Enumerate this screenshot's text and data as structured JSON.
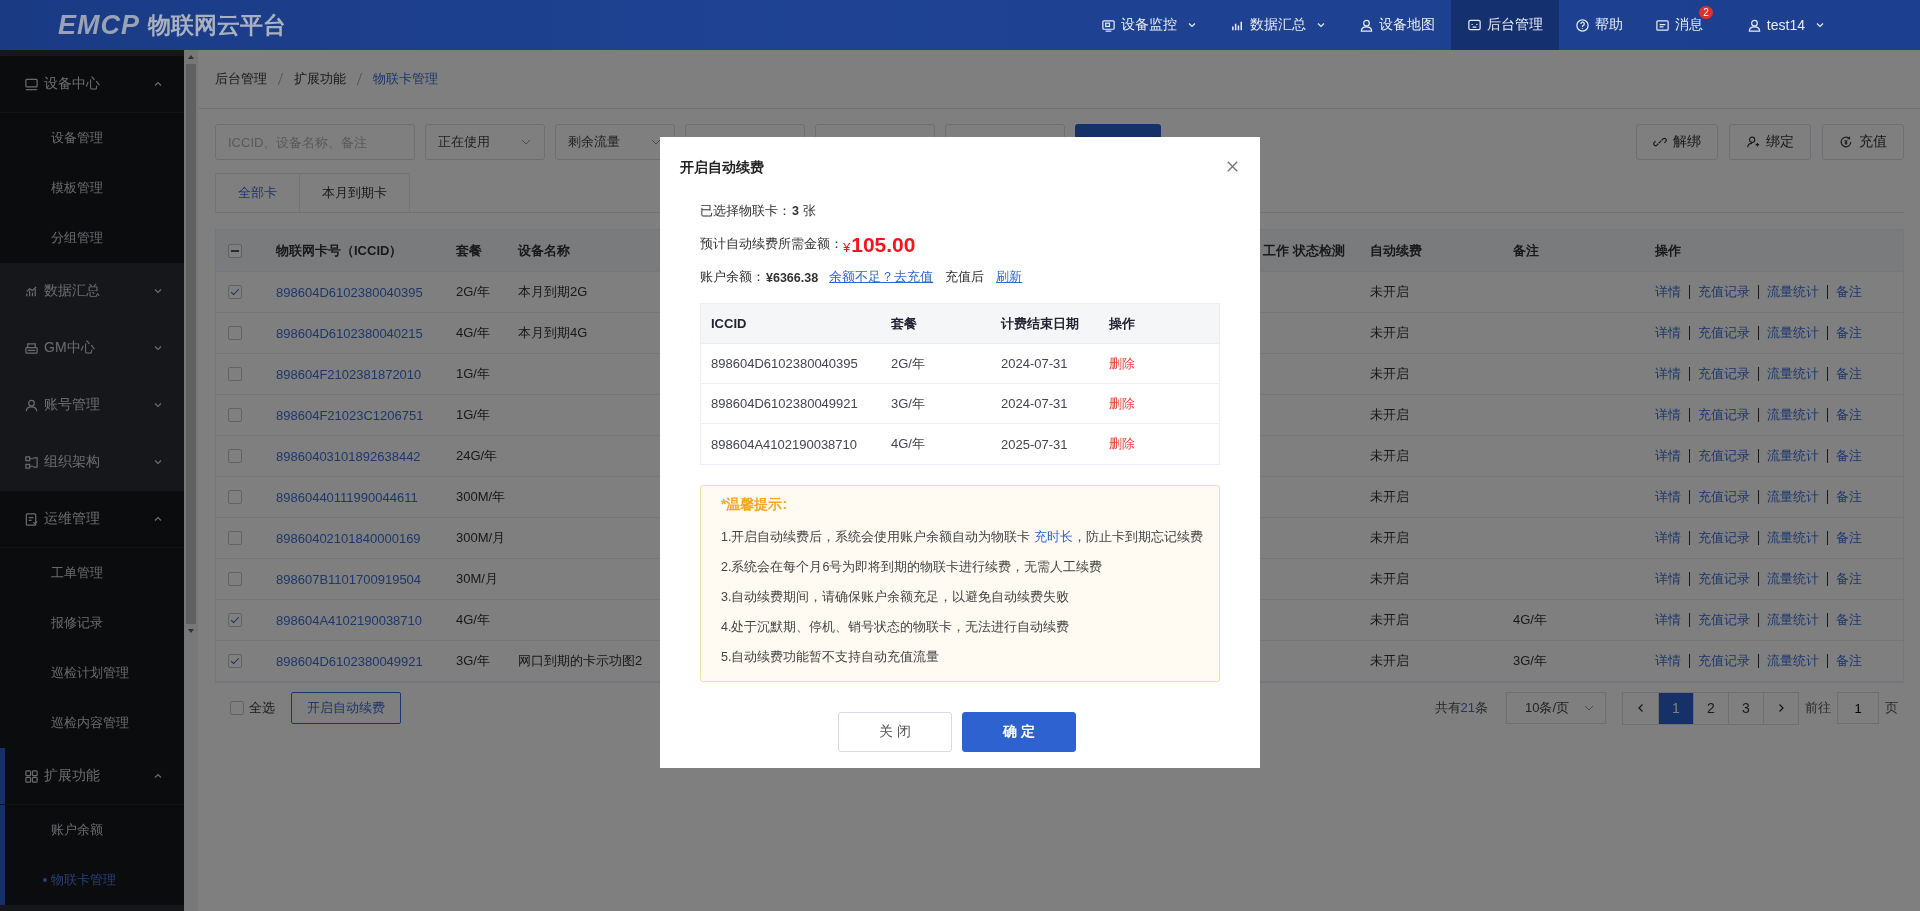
{
  "header": {
    "logo_mark": "EMCP",
    "logo_text": "物联网云平台",
    "nav": [
      {
        "label": "设备监控",
        "dropdown": true,
        "selected": false
      },
      {
        "label": "数据汇总",
        "dropdown": true,
        "selected": false
      },
      {
        "label": "设备地图",
        "dropdown": false,
        "selected": false
      },
      {
        "label": "后台管理",
        "dropdown": false,
        "selected": true
      },
      {
        "label": "帮助",
        "dropdown": false,
        "selected": false
      },
      {
        "label": "消息",
        "dropdown": false,
        "selected": false,
        "badge": "2"
      }
    ],
    "user": {
      "name": "test14",
      "dropdown": true
    }
  },
  "sidebar": {
    "groups": [
      {
        "label": "设备中心",
        "expanded": true,
        "active": false,
        "children": [
          {
            "label": "设备管理",
            "selected": false
          },
          {
            "label": "模板管理",
            "selected": false
          },
          {
            "label": "分组管理",
            "selected": false
          }
        ]
      },
      {
        "label": "数据汇总",
        "expanded": false,
        "active": false
      },
      {
        "label": "GM中心",
        "expanded": false,
        "active": false
      },
      {
        "label": "账号管理",
        "expanded": false,
        "active": false
      },
      {
        "label": "组织架构",
        "expanded": false,
        "active": false
      },
      {
        "label": "运维管理",
        "expanded": true,
        "active": false,
        "children": [
          {
            "label": "工单管理",
            "selected": false
          },
          {
            "label": "报修记录",
            "selected": false
          },
          {
            "label": "巡检计划管理",
            "selected": false
          },
          {
            "label": "巡检内容管理",
            "selected": false
          }
        ]
      },
      {
        "label": "扩展功能",
        "expanded": true,
        "active": true,
        "children": [
          {
            "label": "账户余额",
            "selected": false
          },
          {
            "label": "物联卡管理",
            "selected": true
          }
        ]
      }
    ]
  },
  "breadcrumb": [
    "后台管理",
    "扩展功能",
    "物联卡管理"
  ],
  "filters": [
    {
      "kind": "search",
      "placeholder": "ICCID、设备名称、备注"
    },
    {
      "kind": "select",
      "value": "正在使用"
    },
    {
      "kind": "select",
      "value": "剩余流量"
    },
    {
      "kind": "select"
    },
    {
      "kind": "select"
    },
    {
      "kind": "select"
    },
    {
      "kind": "button"
    }
  ],
  "actions": [
    "解绑",
    "绑定",
    "充值"
  ],
  "tabs": [
    {
      "label": "全部卡",
      "selected": true
    },
    {
      "label": "本月到期卡",
      "selected": false
    }
  ],
  "table": {
    "header_indeterminate": true,
    "columns": [
      "物联网卡号（ICCID）",
      "套餐",
      "设备名称",
      "工作 状态检测",
      "自动续费",
      "备注",
      "操作"
    ],
    "rows": [
      {
        "checked": true,
        "iccid": "898604D6102380040395",
        "plan": "2G/年",
        "device": "本月到期2G",
        "auto_renew": "未开启",
        "actions": [
          "详情",
          "充值记录",
          "流量统计",
          "备注"
        ]
      },
      {
        "checked": false,
        "iccid": "898604D6102380040215",
        "plan": "4G/年",
        "device": "本月到期4G",
        "auto_renew": "未开启",
        "actions": [
          "详情",
          "充值记录",
          "流量统计",
          "备注"
        ]
      },
      {
        "checked": false,
        "iccid": "898604F2102381872010",
        "plan": "1G/年",
        "auto_renew": "未开启",
        "actions": [
          "详情",
          "充值记录",
          "流量统计",
          "备注"
        ]
      },
      {
        "checked": false,
        "iccid": "898604F21023C1206751",
        "plan": "1G/年",
        "auto_renew": "未开启",
        "actions": [
          "详情",
          "充值记录",
          "流量统计",
          "备注"
        ]
      },
      {
        "checked": false,
        "iccid": "89860403101892638442",
        "plan": "24G/年",
        "auto_renew": "未开启",
        "actions": [
          "详情",
          "充值记录",
          "流量统计",
          "备注"
        ]
      },
      {
        "checked": false,
        "iccid": "89860440111990044611",
        "plan": "300M/年",
        "auto_renew": "未开启",
        "actions": [
          "详情",
          "充值记录",
          "流量统计",
          "备注"
        ]
      },
      {
        "checked": false,
        "iccid": "89860402101840000169",
        "plan": "300M/月",
        "auto_renew": "未开启",
        "actions": [
          "详情",
          "充值记录",
          "流量统计",
          "备注"
        ]
      },
      {
        "checked": false,
        "iccid": "898607B1101700919504",
        "plan": "30M/月",
        "auto_renew": "未开启",
        "actions": [
          "详情",
          "充值记录",
          "流量统计",
          "备注"
        ]
      },
      {
        "checked": true,
        "iccid": "898604A4102190038710",
        "plan": "4G/年",
        "auto_renew": "未开启",
        "note": "4G/年",
        "actions": [
          "详情",
          "充值记录",
          "流量统计",
          "备注"
        ]
      },
      {
        "checked": true,
        "iccid": "898604D6102380049921",
        "plan": "3G/年",
        "device": "网口到期的卡示功图2",
        "auto_renew": "未开启",
        "note": "3G/年",
        "actions": [
          "详情",
          "充值记录",
          "流量统计",
          "备注"
        ]
      }
    ]
  },
  "footer": {
    "select_all": {
      "label": "全选",
      "checked": false
    },
    "button": "开启自动续费",
    "total": {
      "prefix": "共有",
      "count": "21",
      "suffix": "条"
    },
    "page_size": "10条/页",
    "pages": [
      {
        "label": "1",
        "selected": true
      },
      {
        "label": "2",
        "selected": false
      },
      {
        "label": "3",
        "selected": false
      }
    ],
    "jump": {
      "label": "前往",
      "value": "1",
      "suffix": "页"
    }
  },
  "modal": {
    "title": "开启自动续费",
    "selected_line": {
      "label": "已选择物联卡：",
      "count": "3",
      "unit": "张"
    },
    "amount": {
      "label": "预计自动续费所需金额：",
      "currency": "¥",
      "value": "105.00"
    },
    "balance": {
      "label": "账户余额：",
      "value": "¥6366.38",
      "recharge_link": "余额不足？去充值",
      "after_text": "充值后",
      "refresh_link": "刷新"
    },
    "table": {
      "columns": [
        "ICCID",
        "套餐",
        "计费结束日期",
        "操作"
      ],
      "rows": [
        {
          "iccid": "898604D6102380040395",
          "plan": "2G/年",
          "end_date": "2024-07-31",
          "action": "删除"
        },
        {
          "iccid": "898604D6102380049921",
          "plan": "3G/年",
          "end_date": "2024-07-31",
          "action": "删除"
        },
        {
          "iccid": "898604A4102190038710",
          "plan": "4G/年",
          "end_date": "2025-07-31",
          "action": "删除"
        }
      ]
    },
    "tips": {
      "title": "*温馨提示:",
      "items": [
        [
          {
            "text": "1.开启自动续费后，系统会使用账户余额自动为物联卡 ",
            "highlight": false
          },
          {
            "text": "充时长",
            "highlight": true
          },
          {
            "text": "，防止卡到期忘记续费",
            "highlight": false
          }
        ],
        [
          {
            "text": "2.系统会在每个月6号为即将到期的物联卡进行续费，无需人工续费",
            "highlight": false
          }
        ],
        [
          {
            "text": "3.自动续费期间，请确保账户余额充足，以避免自动续费失败",
            "highlight": false
          }
        ],
        [
          {
            "text": "4.处于沉默期、停机、销号状态的物联卡，无法进行自动续费",
            "highlight": false
          }
        ],
        [
          {
            "text": "5.自动续费功能暂不支持自动充值流量",
            "highlight": false
          }
        ]
      ]
    },
    "buttons": [
      {
        "label": "关 闭",
        "kind": "secondary"
      },
      {
        "label": "确 定",
        "kind": "primary"
      }
    ]
  }
}
